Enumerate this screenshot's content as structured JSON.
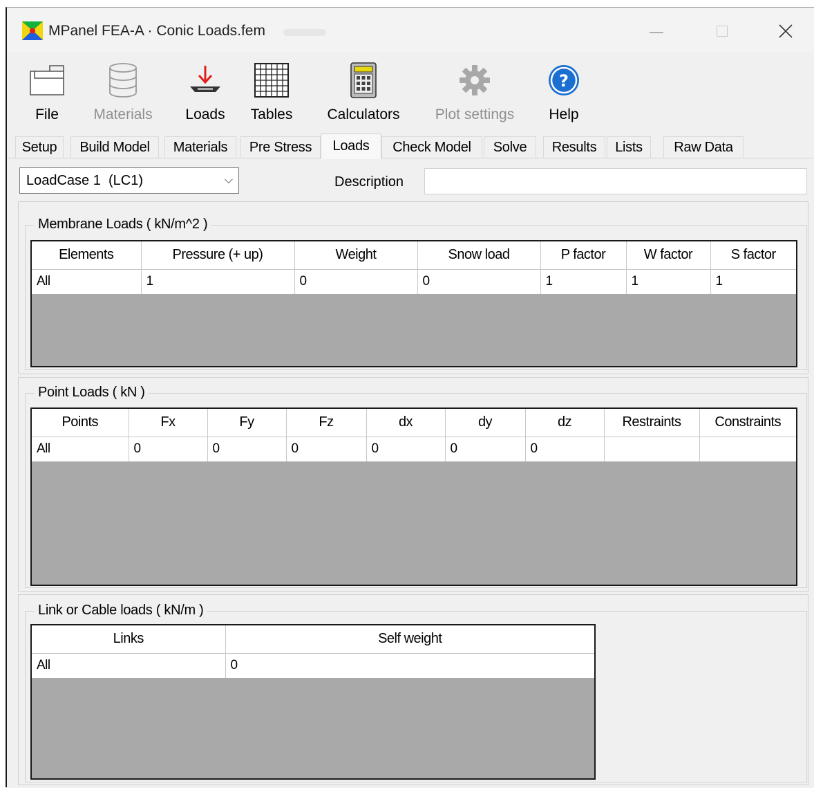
{
  "window": {
    "title": "MPanel FEA-A · Conic Loads.fem"
  },
  "toolbar": {
    "file": "File",
    "materials": "Materials",
    "loads": "Loads",
    "tables": "Tables",
    "calculators": "Calculators",
    "plot_settings": "Plot settings",
    "help": "Help"
  },
  "tabs": [
    "Setup",
    "Build Model",
    "Materials",
    "Pre Stress",
    "Loads",
    "Check Model",
    "Solve",
    "Results",
    "Lists",
    "Raw Data"
  ],
  "active_tab": "Loads",
  "loadcase": {
    "selected": "LoadCase 1  (LC1)",
    "description_label": "Description",
    "description_value": ""
  },
  "membrane": {
    "title": "Membrane Loads ( kN/m^2 )",
    "headers": [
      "Elements",
      "Pressure (+ up)",
      "Weight",
      "Snow load",
      "P factor",
      "W factor",
      "S factor"
    ],
    "rows": [
      [
        "All",
        "1",
        "0",
        "0",
        "1",
        "1",
        "1"
      ]
    ]
  },
  "point": {
    "title": "Point Loads ( kN )",
    "headers": [
      "Points",
      "Fx",
      "Fy",
      "Fz",
      "dx",
      "dy",
      "dz",
      "Restraints",
      "Constraints"
    ],
    "rows": [
      [
        "All",
        "0",
        "0",
        "0",
        "0",
        "0",
        "0",
        "",
        ""
      ]
    ]
  },
  "link": {
    "title": "Link or Cable loads ( kN/m )",
    "headers": [
      "Links",
      "Self weight"
    ],
    "rows": [
      [
        "All",
        "0"
      ]
    ]
  },
  "colors": {
    "accent_red": "#e0201c",
    "help_blue": "#1b6fd1",
    "grid_empty": "#a9a9a9"
  }
}
